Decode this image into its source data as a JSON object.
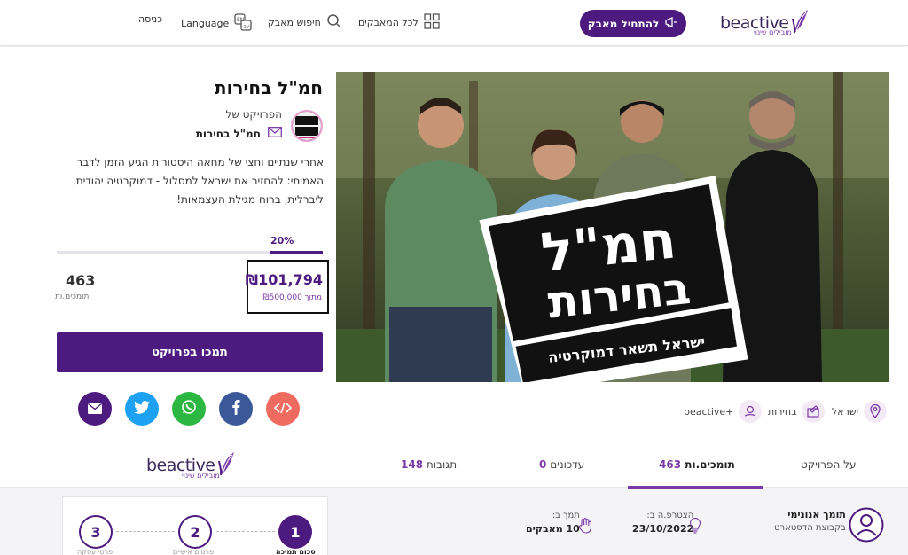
{
  "header": {
    "brand": "beactive",
    "brand_tagline": "מובילים שינוי",
    "start_campaign": "להתחיל מאבק",
    "all_campaigns": "לכל המאבקים",
    "search_campaign": "חיפוש מאבק",
    "language": "Language",
    "login": "כניסה"
  },
  "project": {
    "title": "חמ\"ל בחירות",
    "project_of": "הפרויקט של",
    "owner": "חמ\"ל בחירות",
    "description": "אחרי שנתיים וחצי של מחאה היסטורית הגיע הזמן לדבר האמיתי: להחזיר את ישראל למסלול - דמוקרטיה יהודית, ליברלית, ברוח מגילת העצמאות!",
    "progress_percent": "20%",
    "progress_fraction": 0.2,
    "supporters_count": "463",
    "supporters_label": "תומכים.ות",
    "raised": "₪101,794",
    "raised_of": "מתוך ₪500,000",
    "support_button": "תמכו בפרויקט",
    "hero_overlay_line1": "חמ\"ל",
    "hero_overlay_line2": "בחירות",
    "hero_overlay_line3": "ישראל תשאר דמוקרטיה"
  },
  "share": [
    {
      "name": "embed",
      "color": "#f06b5f"
    },
    {
      "name": "facebook",
      "color": "#3b5998"
    },
    {
      "name": "whatsapp",
      "color": "#2cb742"
    },
    {
      "name": "twitter",
      "color": "#1da1f2"
    },
    {
      "name": "email",
      "color": "#4d1a7f"
    }
  ],
  "tags": {
    "location": "ישראל",
    "category": "בחירות",
    "program": "beactive+"
  },
  "tabs": {
    "about": "על הפרויקט",
    "supporters_label": "תומכים.ות",
    "supporters_count": "463",
    "updates_label": "עדכונים",
    "updates_count": "0",
    "comments_label": "תגובות",
    "comments_count": "148"
  },
  "supporter": {
    "name": "תומך אנונימי",
    "group": "בקבוצת הדסטארט",
    "joined_label": "הצטרפ.ה ב:",
    "joined_date": "23/10/2022",
    "supported_label": "תמך ב:",
    "supported_value": "10 מאבקים"
  },
  "steps": [
    {
      "n": "1",
      "label": "סכום תמיכה"
    },
    {
      "n": "2",
      "label": "פרטים אישיים"
    },
    {
      "n": "3",
      "label": "פרטי עסקה"
    }
  ],
  "colors": {
    "brand_purple": "#4d1a7f",
    "accent_purple": "#7a3aa8"
  }
}
